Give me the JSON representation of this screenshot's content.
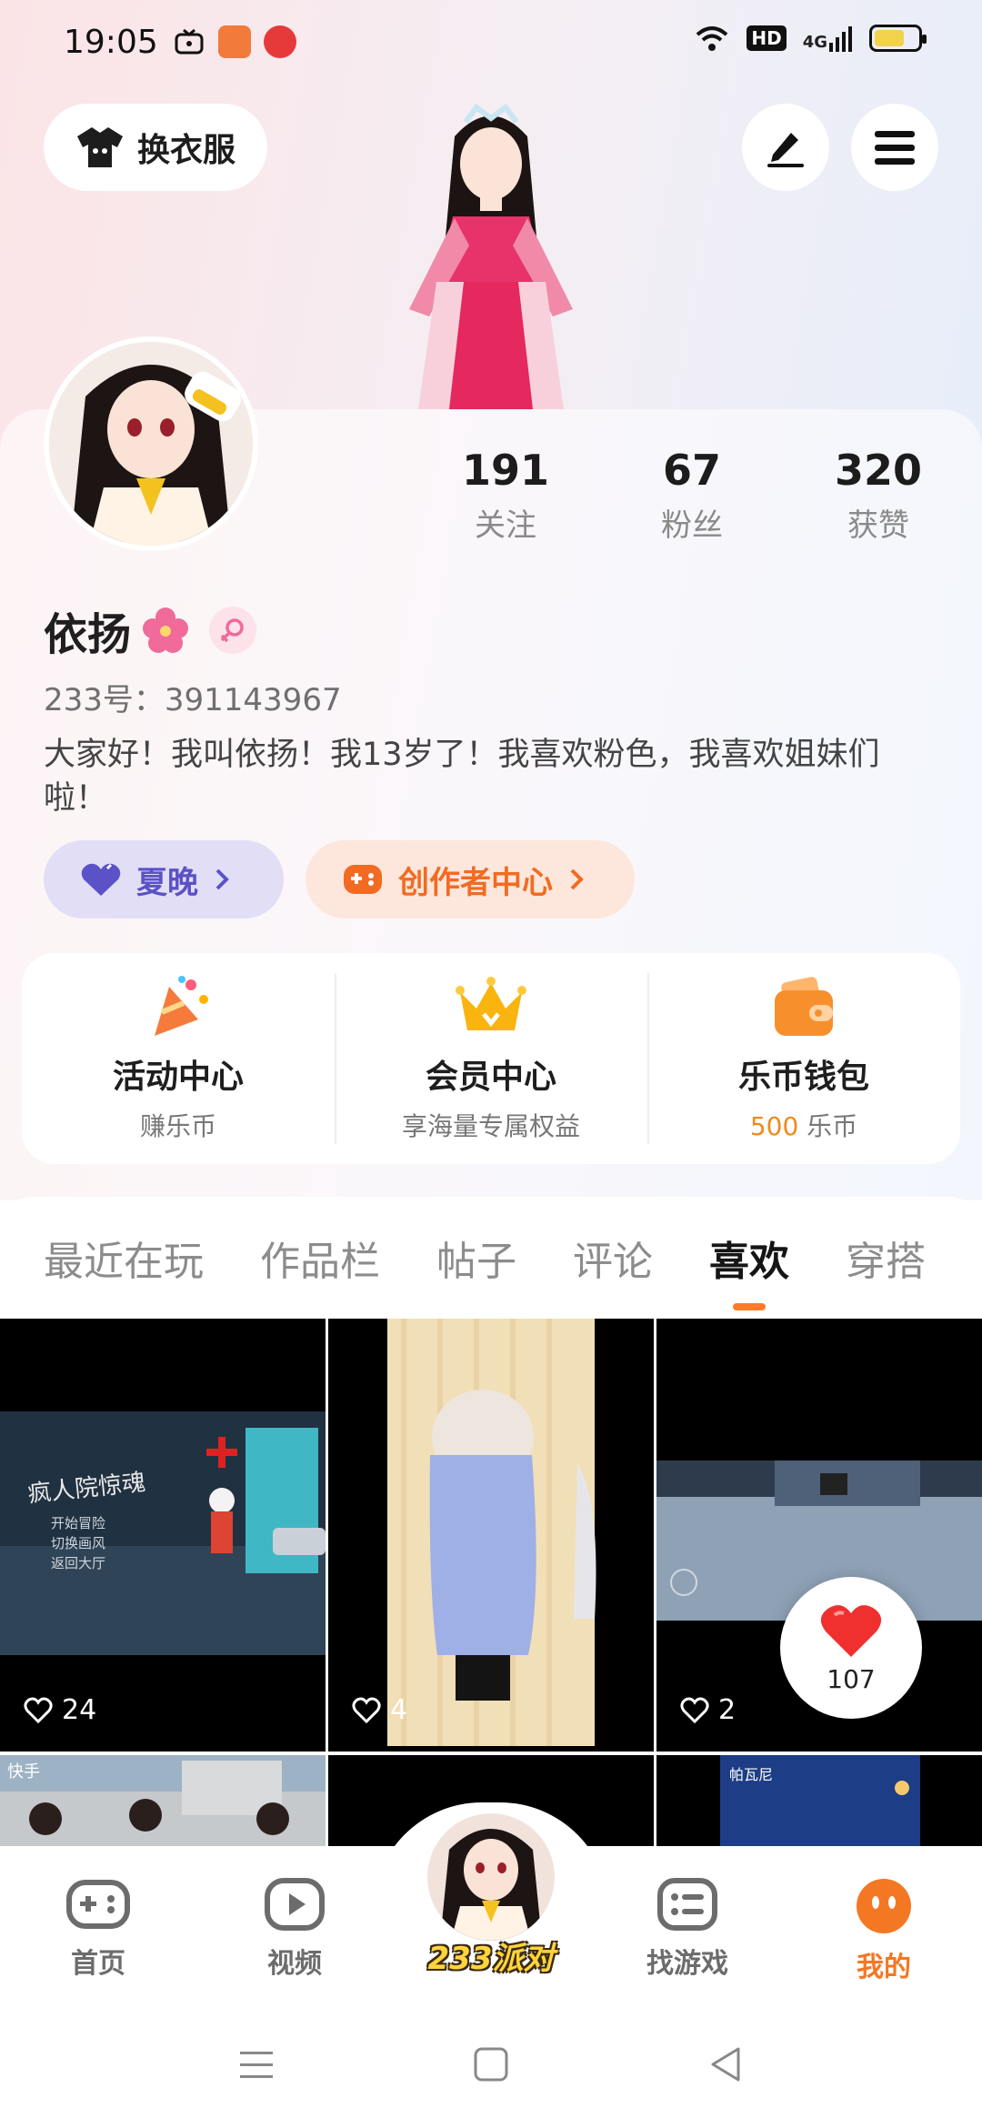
{
  "status_bar": {
    "time": "19:05",
    "network": "4G",
    "hd": "HD",
    "icons": [
      "wifi-icon",
      "signal-icon",
      "battery-icon"
    ]
  },
  "header": {
    "outfit_button": "换衣服",
    "edit_icon": "pencil-icon",
    "menu_icon": "menu-icon"
  },
  "profile": {
    "stats": [
      {
        "value": "191",
        "label": "关注"
      },
      {
        "value": "67",
        "label": "粉丝"
      },
      {
        "value": "320",
        "label": "获赞"
      }
    ],
    "name": "依扬",
    "id_line": "233号：391143967",
    "bio": "大家好！我叫依扬！我13岁了！我喜欢粉色，我喜欢姐妹们啦！",
    "tags": [
      {
        "label": "夏晚",
        "icon": "heart-icon",
        "color": "#5b52c7"
      },
      {
        "label": "创作者中心",
        "icon": "gamepad-icon",
        "color": "#f26b22"
      }
    ]
  },
  "features": [
    {
      "title": "活动中心",
      "sub": "赚乐币",
      "icon": "party-popper-icon"
    },
    {
      "title": "会员中心",
      "sub": "享海量专属权益",
      "icon": "crown-icon"
    },
    {
      "title": "乐币钱包",
      "sub_value": "500",
      "sub_unit": "乐币",
      "icon": "wallet-icon"
    }
  ],
  "tabs": [
    {
      "label": "最近在玩",
      "active": false
    },
    {
      "label": "作品栏",
      "active": false
    },
    {
      "label": "帖子",
      "active": false
    },
    {
      "label": "评论",
      "active": false
    },
    {
      "label": "喜欢",
      "active": true
    },
    {
      "label": "穿搭",
      "active": false
    }
  ],
  "grid": {
    "items": [
      {
        "likes": "24",
        "caption": "疯人院惊魂",
        "menu": [
          "开始冒险",
          "切换画风",
          "返回大厅"
        ]
      },
      {
        "likes": "4"
      },
      {
        "likes": "2"
      },
      {
        "caption": "快手"
      },
      {},
      {
        "caption": "帕瓦尼"
      }
    ],
    "floating_like_count": "107"
  },
  "bottom_nav": [
    {
      "label": "首页",
      "icon": "gamepad-icon",
      "active": false
    },
    {
      "label": "视频",
      "icon": "play-icon",
      "active": false
    },
    {
      "label": "233派对",
      "icon": "avatar",
      "active": false
    },
    {
      "label": "找游戏",
      "icon": "list-icon",
      "active": false
    },
    {
      "label": "我的",
      "icon": "face-icon",
      "active": true
    }
  ],
  "colors": {
    "accent": "#ff7a29",
    "purple": "#5b52c7",
    "gold": "#f08a1d"
  }
}
